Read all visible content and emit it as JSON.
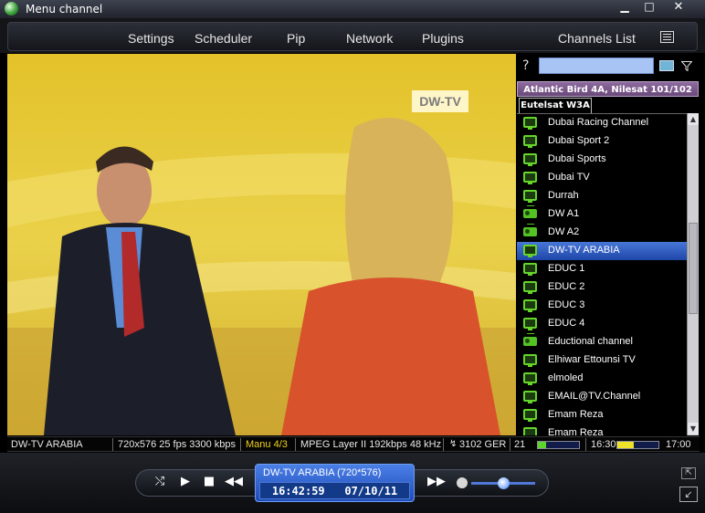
{
  "window": {
    "title": "Menu channel",
    "minimize_icon": "minimize-icon",
    "maximize_icon": "maximize-icon",
    "close_icon": "close-icon"
  },
  "menu": {
    "items": [
      "Settings",
      "Scheduler",
      "Pip",
      "Network",
      "Plugins"
    ],
    "channels_list": "Channels List"
  },
  "video": {
    "logo": "DW-TV"
  },
  "panel": {
    "help": "?",
    "search_value": "",
    "satellite": "Atlantic Bird 4A, Nilesat 101/102",
    "tab": "Eutelsat W3A",
    "channels": [
      {
        "label": "Dubai Racing Channel",
        "icon": "tv-icon",
        "selected": false
      },
      {
        "label": "Dubai Sport 2",
        "icon": "tv-icon",
        "selected": false
      },
      {
        "label": "Dubai Sports",
        "icon": "tv-icon",
        "selected": false
      },
      {
        "label": "Dubai TV",
        "icon": "tv-icon",
        "selected": false
      },
      {
        "label": "Durrah",
        "icon": "tv-icon",
        "selected": false
      },
      {
        "label": "DW A1",
        "icon": "radio-icon",
        "selected": false
      },
      {
        "label": "DW A2",
        "icon": "radio-icon",
        "selected": false
      },
      {
        "label": "DW-TV ARABIA",
        "icon": "tv-icon",
        "selected": true
      },
      {
        "label": "EDUC 1",
        "icon": "tv-icon",
        "selected": false
      },
      {
        "label": "EDUC 2",
        "icon": "tv-icon",
        "selected": false
      },
      {
        "label": "EDUC 3",
        "icon": "tv-icon",
        "selected": false
      },
      {
        "label": "EDUC 4",
        "icon": "tv-icon",
        "selected": false
      },
      {
        "label": "Eductional channel",
        "icon": "radio-icon",
        "selected": false
      },
      {
        "label": "Elhiwar Ettounsi TV",
        "icon": "tv-icon",
        "selected": false
      },
      {
        "label": "elmoled",
        "icon": "tv-icon",
        "selected": false
      },
      {
        "label": "EMAIL@TV.Channel",
        "icon": "tv-icon",
        "selected": false
      },
      {
        "label": "Emam Reza",
        "icon": "tv-icon",
        "selected": false
      },
      {
        "label": "Emam Reza",
        "icon": "tv-icon",
        "selected": false
      }
    ]
  },
  "status": {
    "channel": "DW-TV ARABIA",
    "video_info": "720x576 25 fps 3300 kbps",
    "aspect": "Manu 4/3",
    "audio_info": "MPEG Layer II 192kbps 48 kHz",
    "audio_track": "3102 GER",
    "signal_partial": "21",
    "signal_level": 0.2,
    "epg_start": "16:30",
    "epg_progress": 0.4,
    "epg_end": "17:00"
  },
  "player": {
    "lcd_title": "DW-TV ARABIA (720*576)",
    "time": "16:42:59",
    "date": "07/10/11",
    "volume": 0.5
  },
  "colors": {
    "accent": "#3866d0",
    "channel_icon": "#66d52a",
    "aspect_text": "#f2d21c"
  }
}
